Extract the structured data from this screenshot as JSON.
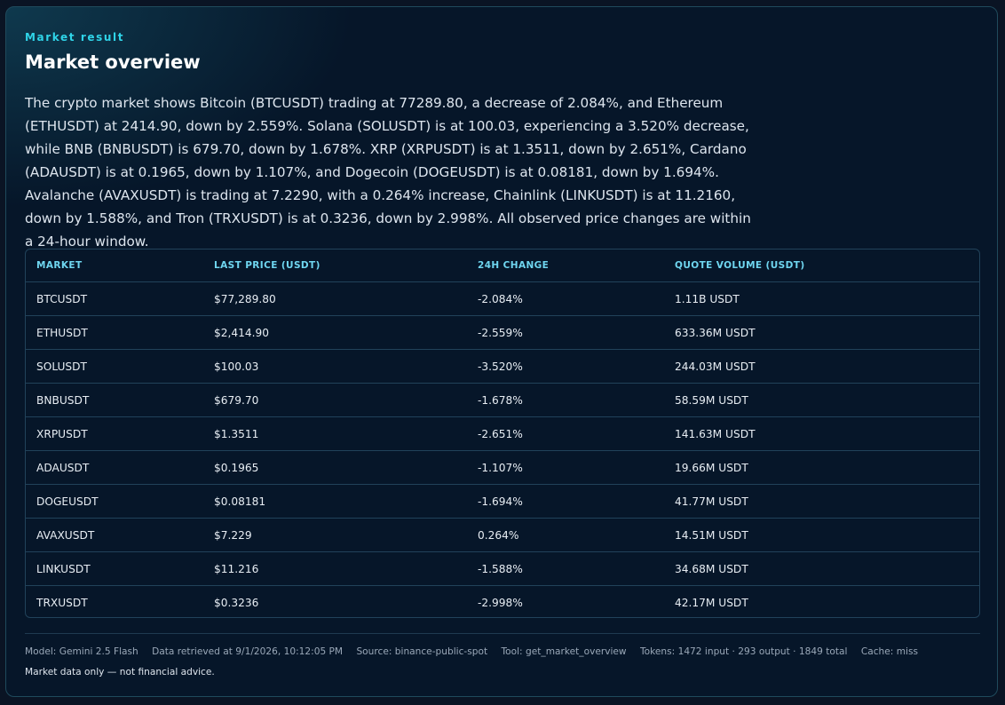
{
  "header": {
    "eyebrow": "Market result",
    "title": "Market overview"
  },
  "summary": "The crypto market shows Bitcoin (BTCUSDT) trading at 77289.80, a decrease of 2.084%, and Ethereum (ETHUSDT) at 2414.90, down by 2.559%. Solana (SOLUSDT) is at 100.03, experiencing a 3.520% decrease, while BNB (BNBUSDT) is 679.70, down by 1.678%. XRP (XRPUSDT) is at 1.3511, down by 2.651%, Cardano (ADAUSDT) is at 0.1965, down by 1.107%, and Dogecoin (DOGEUSDT) is at 0.08181, down by 1.694%. Avalanche (AVAXUSDT) is trading at 7.2290, with a 0.264% increase, Chainlink (LINKUSDT) is at 11.2160, down by 1.588%, and Tron (TRXUSDT) is at 0.3236, down by 2.998%. All observed price changes are within a 24-hour window.",
  "table": {
    "columns": [
      "MARKET",
      "LAST PRICE (USDT)",
      "24H CHANGE",
      "QUOTE VOLUME (USDT)"
    ],
    "rows": [
      [
        "BTCUSDT",
        "$77,289.80",
        "-2.084%",
        "1.11B USDT"
      ],
      [
        "ETHUSDT",
        "$2,414.90",
        "-2.559%",
        "633.36M USDT"
      ],
      [
        "SOLUSDT",
        "$100.03",
        "-3.520%",
        "244.03M USDT"
      ],
      [
        "BNBUSDT",
        "$679.70",
        "-1.678%",
        "58.59M USDT"
      ],
      [
        "XRPUSDT",
        "$1.3511",
        "-2.651%",
        "141.63M USDT"
      ],
      [
        "ADAUSDT",
        "$0.1965",
        "-1.107%",
        "19.66M USDT"
      ],
      [
        "DOGEUSDT",
        "$0.08181",
        "-1.694%",
        "41.77M USDT"
      ],
      [
        "AVAXUSDT",
        "$7.229",
        "0.264%",
        "14.51M USDT"
      ],
      [
        "LINKUSDT",
        "$11.216",
        "-1.588%",
        "34.68M USDT"
      ],
      [
        "TRXUSDT",
        "$0.3236",
        "-2.998%",
        "42.17M USDT"
      ]
    ]
  },
  "footer": {
    "meta": [
      "Model: Gemini 2.5 Flash",
      "Data retrieved at 9/1/2026, 10:12:05 PM",
      "Source: binance-public-spot",
      "Tool: get_market_overview",
      "Tokens: 1472 input · 293 output · 1849 total",
      "Cache: miss"
    ],
    "disclaimer": "Market data only — not financial advice."
  },
  "colors": {
    "accent": "#2fd4e8",
    "header_text": "#6fd6f0",
    "background": "#061629",
    "border": "#21425a"
  }
}
